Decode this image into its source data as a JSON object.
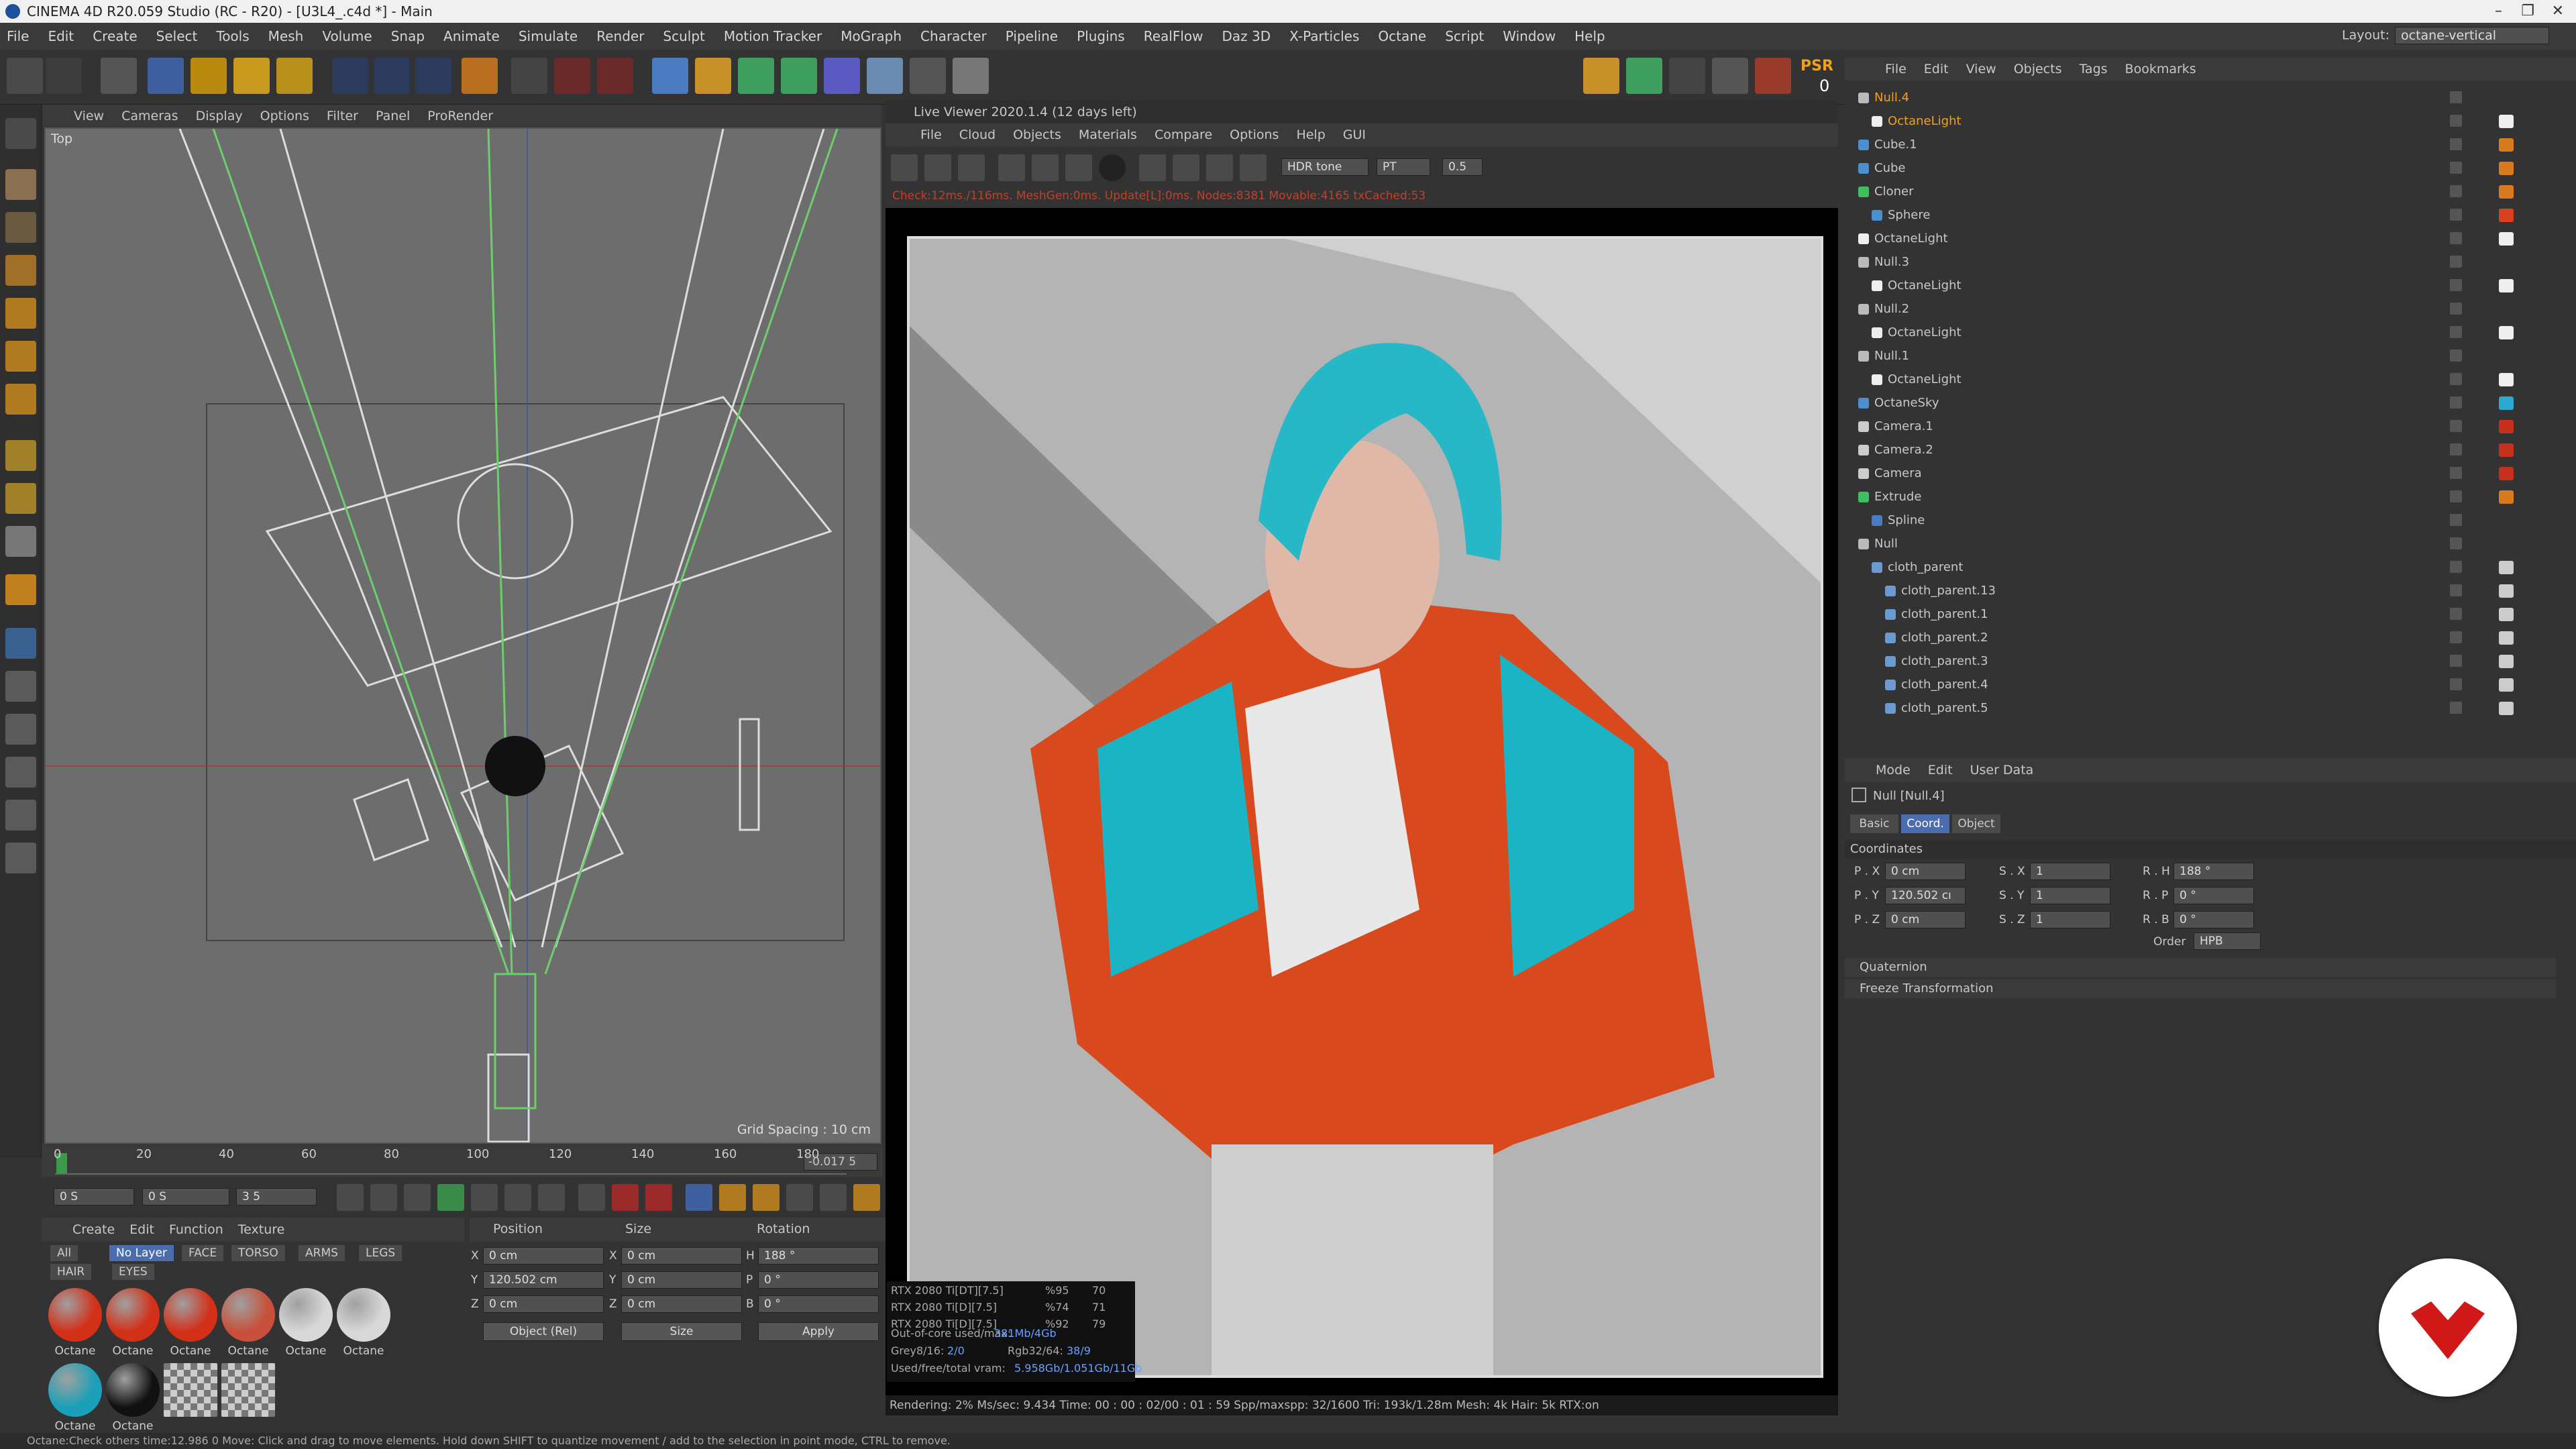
{
  "titlebar": {
    "title": "CINEMA 4D R20.059 Studio (RC - R20) - [U3L4_.c4d *] - Main"
  },
  "menubar": {
    "items": [
      "File",
      "Edit",
      "Create",
      "Select",
      "Tools",
      "Mesh",
      "Volume",
      "Snap",
      "Animate",
      "Simulate",
      "Render",
      "Sculpt",
      "Motion Tracker",
      "MoGraph",
      "Character",
      "Pipeline",
      "Plugins",
      "RealFlow",
      "Daz 3D",
      "X-Particles",
      "Octane",
      "Script",
      "Window",
      "Help"
    ],
    "layout_label": "Layout:",
    "layout_value": "octane-vertical"
  },
  "toolbar": {
    "psr_label": "PSR",
    "psr_value": "0"
  },
  "viewport": {
    "menu": [
      "View",
      "Cameras",
      "Display",
      "Options",
      "Filter",
      "Panel",
      "ProRender"
    ],
    "view_label": "Top",
    "grid_spacing": "Grid Spacing : 10 cm"
  },
  "timeline": {
    "ticks": [
      "0",
      "20",
      "40",
      "60",
      "80",
      "100",
      "120",
      "140",
      "160",
      "180"
    ],
    "current_frame": "-0.017 5",
    "start": "0 S",
    "preview_start": "0 S",
    "end": "3 5"
  },
  "material_manager": {
    "menu": [
      "Create",
      "Edit",
      "Function",
      "Texture"
    ],
    "filters_row1": [
      "All",
      "No Layer",
      "FACE",
      "TORSO",
      "ARMS",
      "LEGS"
    ],
    "filters_row2": [
      "HAIR",
      "EYES"
    ],
    "materials": [
      {
        "name": "Octane",
        "color": "#d33018"
      },
      {
        "name": "Octane",
        "color": "#d33018"
      },
      {
        "name": "Octane",
        "color": "#d33018"
      },
      {
        "name": "Octane",
        "color": "#c8503a"
      },
      {
        "name": "Octane",
        "color": "#d8d8d8"
      },
      {
        "name": "Octane",
        "color": "#d8d8d8"
      },
      {
        "name": "Octane",
        "color": "#1aa0b8"
      },
      {
        "name": "Octane",
        "color": "#111111"
      },
      {
        "name": "",
        "color": "#999999"
      },
      {
        "name": "",
        "color": "#999999"
      }
    ]
  },
  "coord_manager": {
    "headers": [
      "Position",
      "Size",
      "Rotation"
    ],
    "rows": [
      {
        "axis": "X",
        "pos": "0 cm",
        "size": "0 cm",
        "rlabel": "H",
        "rot": "188 °"
      },
      {
        "axis": "Y",
        "pos": "120.502 cm",
        "size": "0 cm",
        "rlabel": "P",
        "rot": "0 °"
      },
      {
        "axis": "Z",
        "pos": "0 cm",
        "size": "0 cm",
        "rlabel": "B",
        "rot": "0 °"
      }
    ],
    "mode": "Object (Rel)",
    "size_mode": "Size",
    "apply": "Apply"
  },
  "live_viewer": {
    "title": "Live Viewer 2020.1.4 (12 days left)",
    "menu": [
      "File",
      "Cloud",
      "Objects",
      "Materials",
      "Compare",
      "Options",
      "Help",
      "GUI"
    ],
    "tonemap": "HDR tone",
    "kernel": "PT",
    "value": "0.5",
    "status": "Check:12ms./116ms. MeshGen:0ms. Update[L]:0ms. Nodes:8381 Movable:4165 txCached:53",
    "gpus": [
      {
        "name": "RTX 2080 Ti[DT][7.5]",
        "pct": "%95",
        "temp": "70"
      },
      {
        "name": "RTX 2080 Ti[D][7.5]",
        "pct": "%74",
        "temp": "71"
      },
      {
        "name": "RTX 2080 Ti[D][7.5]",
        "pct": "%92",
        "temp": "79"
      }
    ],
    "ooc_label": "Out-of-core used/max:",
    "ooc_value": "381Mb/4Gb",
    "grey_label": "Grey8/16:",
    "grey_value": "2/0",
    "rgb_label": "Rgb32/64:",
    "rgb_value": "38/9",
    "vram_label": "Used/free/total vram:",
    "vram_value": "5.958Gb/1.051Gb/11Gb",
    "render_stats": "Rendering: 2%   Ms/sec: 9.434   Time: 00 : 00 : 02/00 : 01 : 59   Spp/maxspp: 32/1600   Tri: 193k/1.28m   Mesh: 4k   Hair: 5k   RTX:on"
  },
  "object_manager": {
    "menu": [
      "File",
      "Edit",
      "View",
      "Objects",
      "Tags",
      "Bookmarks"
    ],
    "objects": [
      {
        "name": "Null.4",
        "depth": 0,
        "type": "null",
        "selected": true
      },
      {
        "name": "OctaneLight",
        "depth": 1,
        "type": "light",
        "selected": true
      },
      {
        "name": "Cube.1",
        "depth": 0,
        "type": "cube"
      },
      {
        "name": "Cube",
        "depth": 0,
        "type": "cube"
      },
      {
        "name": "Cloner",
        "depth": 0,
        "type": "cloner"
      },
      {
        "name": "Sphere",
        "depth": 1,
        "type": "sphere"
      },
      {
        "name": "OctaneLight",
        "depth": 0,
        "type": "light"
      },
      {
        "name": "Null.3",
        "depth": 0,
        "type": "null"
      },
      {
        "name": "OctaneLight",
        "depth": 1,
        "type": "light"
      },
      {
        "name": "Null.2",
        "depth": 0,
        "type": "null"
      },
      {
        "name": "OctaneLight",
        "depth": 1,
        "type": "light"
      },
      {
        "name": "Null.1",
        "depth": 0,
        "type": "null"
      },
      {
        "name": "OctaneLight",
        "depth": 1,
        "type": "light"
      },
      {
        "name": "OctaneSky",
        "depth": 0,
        "type": "sky"
      },
      {
        "name": "Camera.1",
        "depth": 0,
        "type": "camera"
      },
      {
        "name": "Camera.2",
        "depth": 0,
        "type": "camera"
      },
      {
        "name": "Camera",
        "depth": 0,
        "type": "camera"
      },
      {
        "name": "Extrude",
        "depth": 0,
        "type": "extrude"
      },
      {
        "name": "Spline",
        "depth": 1,
        "type": "spline"
      },
      {
        "name": "Null",
        "depth": 0,
        "type": "null"
      },
      {
        "name": "cloth_parent",
        "depth": 1,
        "type": "joint"
      },
      {
        "name": "cloth_parent.13",
        "depth": 2,
        "type": "joint"
      },
      {
        "name": "cloth_parent.1",
        "depth": 2,
        "type": "joint"
      },
      {
        "name": "cloth_parent.2",
        "depth": 2,
        "type": "joint"
      },
      {
        "name": "cloth_parent.3",
        "depth": 2,
        "type": "joint"
      },
      {
        "name": "cloth_parent.4",
        "depth": 2,
        "type": "joint"
      },
      {
        "name": "cloth_parent.5",
        "depth": 2,
        "type": "joint"
      }
    ]
  },
  "attribute_manager": {
    "menu": [
      "Mode",
      "Edit",
      "User Data"
    ],
    "object_title": "Null [Null.4]",
    "tabs": [
      "Basic",
      "Coord.",
      "Object"
    ],
    "active_tab": "Coord.",
    "section": "Coordinates",
    "rows": [
      {
        "p": "P . X",
        "pv": "0 cm",
        "s": "S . X",
        "sv": "1",
        "r": "R . H",
        "rv": "188 °"
      },
      {
        "p": "P . Y",
        "pv": "120.502 cı",
        "s": "S . Y",
        "sv": "1",
        "r": "R . P",
        "rv": "0 °"
      },
      {
        "p": "P . Z",
        "pv": "0 cm",
        "s": "S . Z",
        "sv": "1",
        "r": "R . B",
        "rv": "0 °"
      }
    ],
    "order_label": "Order",
    "order_value": "HPB",
    "groups": [
      "Quaternion",
      "Freeze Transformation"
    ]
  },
  "statusbar": {
    "text": "Octane:Check others time:12.986 0    Move: Click and drag to move elements. Hold down SHIFT to quantize movement / add to the selection in point mode, CTRL to remove."
  },
  "colors": {
    "accent": "#4c6cb0",
    "selected_text": "#f0a020",
    "status_red": "#c0402a",
    "gpu_blue": "#6aa0ff",
    "grid_green": "#6ccf6c"
  }
}
